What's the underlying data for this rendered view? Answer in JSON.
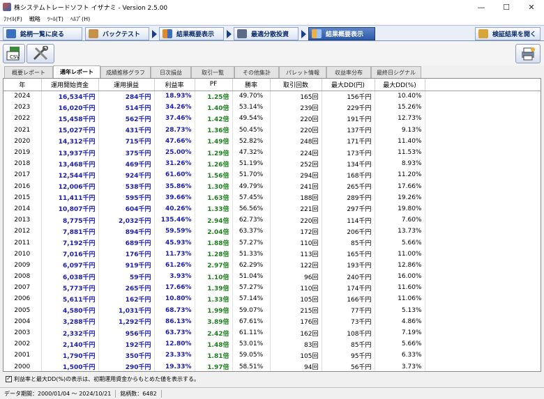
{
  "window": {
    "title": "株システムトレードソフト イザナミ - Version 2.5.00",
    "minimize": "—",
    "maximize": "☐",
    "close": "✕"
  },
  "menu": [
    "ﾌｧｲﾙ(F)",
    "戦略",
    "ﾂｰﾙ(T)",
    "ﾍﾙﾌﾟ(H)"
  ],
  "nav": {
    "stock_list": "銘柄一覧に戻る",
    "backtest": "バックテスト",
    "summary1": "結果概要表示",
    "optimize": "最適分散投資",
    "summary2": "結果概要表示",
    "open_results": "検証結果を開く"
  },
  "toolbar": {
    "csv": "CSV"
  },
  "tabs": [
    "概要レポート",
    "通年レポート",
    "成績推移グラフ",
    "日次損益",
    "取引一覧",
    "その他集計",
    "パレット情報",
    "収益率分布",
    "最終日シグナル"
  ],
  "table": {
    "headers": [
      "年",
      "運用開始資金",
      "運用損益",
      "利益率",
      "PF",
      "勝率",
      "取引回数",
      "最大DD(円)",
      "最大DD(%)"
    ],
    "rows": [
      [
        "2024",
        "16,534千円",
        "284千円",
        "18.93%",
        "1.25倍",
        "49.70%",
        "165回",
        "156千円",
        "10.40%"
      ],
      [
        "2023",
        "16,020千円",
        "514千円",
        "34.26%",
        "1.40倍",
        "53.14%",
        "239回",
        "229千円",
        "15.26%"
      ],
      [
        "2022",
        "15,458千円",
        "562千円",
        "37.46%",
        "1.42倍",
        "49.54%",
        "220回",
        "191千円",
        "12.73%"
      ],
      [
        "2021",
        "15,027千円",
        "431千円",
        "28.73%",
        "1.36倍",
        "50.45%",
        "220回",
        "137千円",
        "9.13%"
      ],
      [
        "2020",
        "14,312千円",
        "715千円",
        "47.66%",
        "1.49倍",
        "52.82%",
        "248回",
        "171千円",
        "11.40%"
      ],
      [
        "2019",
        "13,937千円",
        "375千円",
        "25.00%",
        "1.29倍",
        "47.32%",
        "224回",
        "173千円",
        "11.53%"
      ],
      [
        "2018",
        "13,468千円",
        "469千円",
        "31.26%",
        "1.26倍",
        "51.19%",
        "252回",
        "134千円",
        "8.93%"
      ],
      [
        "2017",
        "12,544千円",
        "924千円",
        "61.60%",
        "1.56倍",
        "51.70%",
        "294回",
        "168千円",
        "11.20%"
      ],
      [
        "2016",
        "12,006千円",
        "538千円",
        "35.86%",
        "1.30倍",
        "49.79%",
        "241回",
        "265千円",
        "17.66%"
      ],
      [
        "2015",
        "11,411千円",
        "595千円",
        "39.66%",
        "1.63倍",
        "57.45%",
        "188回",
        "289千円",
        "19.26%"
      ],
      [
        "2014",
        "10,807千円",
        "604千円",
        "40.26%",
        "1.33倍",
        "56.56%",
        "221回",
        "297千円",
        "19.80%"
      ],
      [
        "2013",
        "8,775千円",
        "2,032千円",
        "135.46%",
        "2.94倍",
        "62.73%",
        "220回",
        "114千円",
        "7.60%"
      ],
      [
        "2012",
        "7,881千円",
        "894千円",
        "59.59%",
        "2.04倍",
        "63.37%",
        "172回",
        "206千円",
        "13.73%"
      ],
      [
        "2011",
        "7,192千円",
        "689千円",
        "45.93%",
        "1.88倍",
        "57.27%",
        "110回",
        "85千円",
        "5.66%"
      ],
      [
        "2010",
        "7,016千円",
        "176千円",
        "11.73%",
        "1.28倍",
        "51.33%",
        "113回",
        "165千円",
        "11.00%"
      ],
      [
        "2009",
        "6,097千円",
        "919千円",
        "61.26%",
        "2.97倍",
        "62.29%",
        "122回",
        "193千円",
        "12.86%"
      ],
      [
        "2008",
        "6,038千円",
        "59千円",
        "3.93%",
        "1.10倍",
        "51.04%",
        "96回",
        "240千円",
        "16.00%"
      ],
      [
        "2007",
        "5,773千円",
        "265千円",
        "17.66%",
        "1.39倍",
        "57.27%",
        "110回",
        "174千円",
        "11.60%"
      ],
      [
        "2006",
        "5,611千円",
        "162千円",
        "10.80%",
        "1.33倍",
        "57.14%",
        "105回",
        "166千円",
        "11.06%"
      ],
      [
        "2005",
        "4,580千円",
        "1,031千円",
        "68.73%",
        "1.99倍",
        "59.07%",
        "215回",
        "77千円",
        "5.13%"
      ],
      [
        "2004",
        "3,288千円",
        "1,292千円",
        "86.13%",
        "3.89倍",
        "67.61%",
        "176回",
        "73千円",
        "4.86%"
      ],
      [
        "2003",
        "2,332千円",
        "956千円",
        "63.73%",
        "2.42倍",
        "61.11%",
        "162回",
        "108千円",
        "7.19%"
      ],
      [
        "2002",
        "2,140千円",
        "192千円",
        "12.80%",
        "1.48倍",
        "53.01%",
        "83回",
        "85千円",
        "5.66%"
      ],
      [
        "2001",
        "1,790千円",
        "350千円",
        "23.33%",
        "1.81倍",
        "59.05%",
        "105回",
        "95千円",
        "6.33%"
      ],
      [
        "2000",
        "1,500千円",
        "290千円",
        "19.33%",
        "1.97倍",
        "58.51%",
        "94回",
        "56千円",
        "3.73%"
      ]
    ]
  },
  "note": {
    "checked": true,
    "text": "利益率と最大DD(%)の表示は、初期運用資金からもとめた値を表示する。"
  },
  "footer": {
    "period": "データ期間：2000/01/04 〜 2024/10/21",
    "stocks": "銘柄数：6482"
  },
  "colors": {
    "blue_value": "#1a1ab4",
    "green_value": "#1c7d1c",
    "nav_active": "#2c5aa8"
  }
}
